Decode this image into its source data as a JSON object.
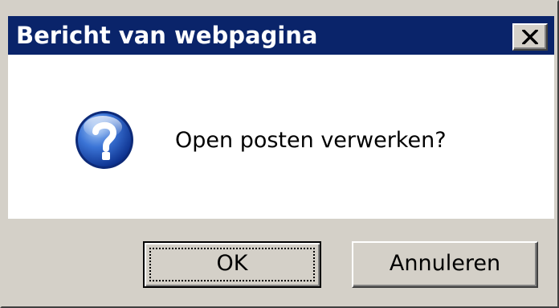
{
  "dialog": {
    "title": "Bericht van webpagina",
    "message": "Open posten verwerken?",
    "icon": "question-icon",
    "buttons": {
      "ok_label": "OK",
      "cancel_label": "Annuleren"
    }
  },
  "colors": {
    "titlebar": "#0a246a",
    "title_text": "#ffffff",
    "dialog_face": "#d4d0c8",
    "content_bg": "#ffffff"
  }
}
